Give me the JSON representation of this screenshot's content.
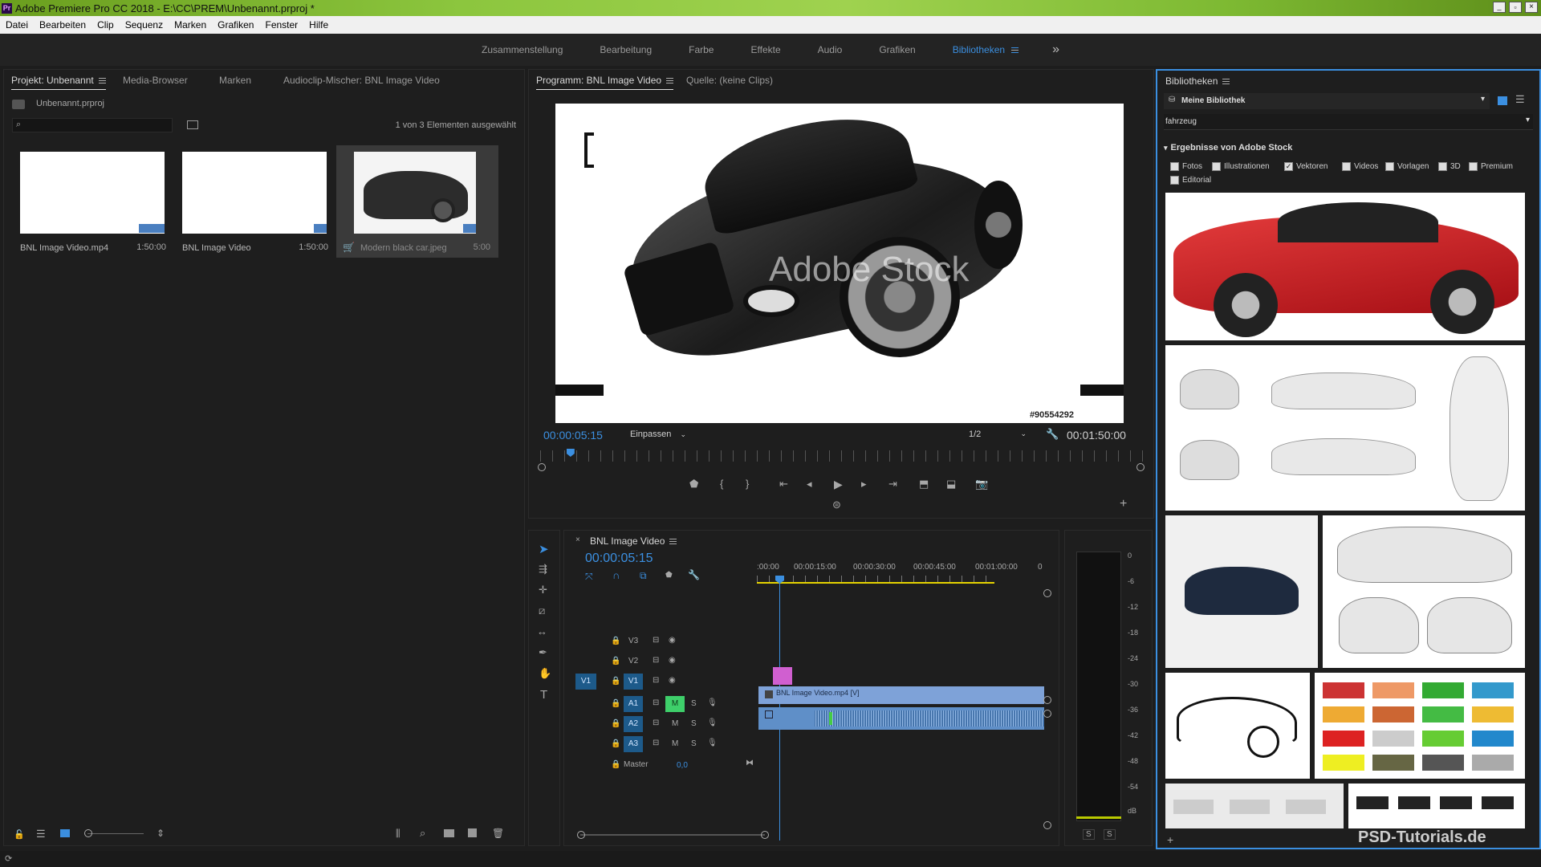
{
  "app": {
    "title": "Adobe Premiere Pro CC 2018 - E:\\CC\\PREM\\Unbenannt.prproj *"
  },
  "menu": [
    "Datei",
    "Bearbeiten",
    "Clip",
    "Sequenz",
    "Marken",
    "Grafiken",
    "Fenster",
    "Hilfe"
  ],
  "workspaces": {
    "items": [
      "Zusammenstellung",
      "Bearbeitung",
      "Farbe",
      "Effekte",
      "Audio",
      "Grafiken",
      "Bibliotheken"
    ],
    "active": "Bibliotheken",
    "more": "»"
  },
  "project": {
    "tabs": [
      "Projekt: Unbenannt",
      "Media-Browser",
      "Marken",
      "Audioclip-Mischer: BNL Image Video"
    ],
    "file": "Unbenannt.prproj",
    "selection_info": "1 von 3 Elementen ausgewählt",
    "items": [
      {
        "name": "BNL Image Video.mp4",
        "duration": "1:50:00"
      },
      {
        "name": "BNL Image Video",
        "duration": "1:50:00"
      },
      {
        "name": "Modern black car.jpeg",
        "duration": "5:00"
      }
    ]
  },
  "program": {
    "tabs": [
      "Programm: BNL Image Video",
      "Quelle: (keine Clips)"
    ],
    "timecode": "00:00:05:15",
    "fit": "Einpassen",
    "resolution": "1/2",
    "duration": "00:01:50:00",
    "watermark": "Adobe Stock",
    "stock_id": "#90554292",
    "playhead_fraction": 0.05
  },
  "timeline": {
    "tab": "BNL Image Video",
    "timecode": "00:00:05:15",
    "ruler": [
      ":00:00",
      "00:00:15:00",
      "00:00:30:00",
      "00:00:45:00",
      "00:01:00:00",
      "0"
    ],
    "tracks": [
      "V3",
      "V2",
      "V1",
      "A1",
      "A2",
      "A3"
    ],
    "source_patch_v": "V1",
    "source_patch_a": "A1",
    "clip_label": "BNL Image Video.mp4 [V]",
    "master_label": "Master",
    "master_value": "0,0",
    "mute": "M",
    "solo": "S"
  },
  "meters": {
    "scale": [
      "0",
      "-6",
      "-12",
      "-18",
      "-24",
      "-30",
      "-36",
      "-42",
      "-48",
      "-54",
      "dB"
    ],
    "solo": [
      "S",
      "S"
    ]
  },
  "libraries": {
    "title": "Bibliotheken",
    "library": "Meine Bibliothek",
    "search": "fahrzeug",
    "section": "Ergebnisse von Adobe Stock",
    "filters": [
      {
        "label": "Fotos",
        "checked": false
      },
      {
        "label": "Illustrationen",
        "checked": false
      },
      {
        "label": "Vektoren",
        "checked": true
      },
      {
        "label": "Videos",
        "checked": false
      },
      {
        "label": "Vorlagen",
        "checked": false
      },
      {
        "label": "3D",
        "checked": false
      },
      {
        "label": "Premium",
        "checked": false
      },
      {
        "label": "Editorial",
        "checked": false
      }
    ],
    "watermark": "PSD-Tutorials.de"
  }
}
